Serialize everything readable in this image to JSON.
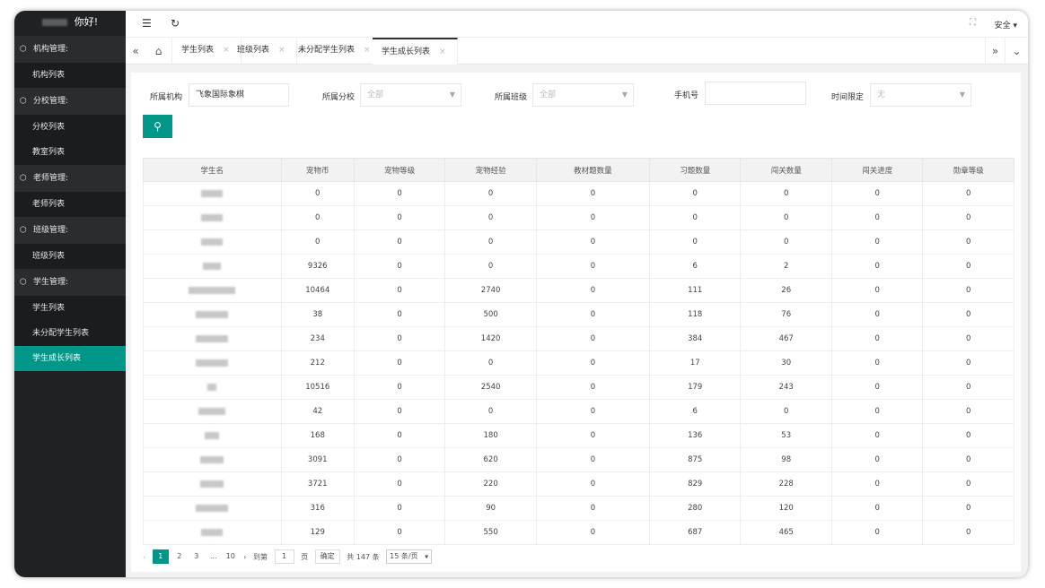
{
  "sidebar": {
    "greeting": "你好!",
    "groups": [
      {
        "label": "机构管理:",
        "items": [
          "机构列表"
        ]
      },
      {
        "label": "分校管理:",
        "items": [
          "分校列表",
          "教室列表"
        ]
      },
      {
        "label": "老师管理:",
        "items": [
          "老师列表"
        ]
      },
      {
        "label": "班级管理:",
        "items": [
          "班级列表"
        ]
      },
      {
        "label": "学生管理:",
        "items": [
          "学生列表",
          "未分配学生列表",
          "学生成长列表"
        ]
      }
    ],
    "active_item": "学生成长列表"
  },
  "topbar": {
    "user_menu": "安全"
  },
  "tabs": [
    {
      "label": "学生列表"
    },
    {
      "label": "班级列表"
    },
    {
      "label": "未分配学生列表"
    },
    {
      "label": "学生成长列表",
      "active": true
    }
  ],
  "filters": {
    "org_label": "所属机构",
    "org_value": "飞象国际象棋",
    "branch_label": "所属分校",
    "branch_value": "全部",
    "class_label": "所属班级",
    "class_value": "全部",
    "phone_label": "手机号",
    "phone_value": "",
    "time_label": "时间限定",
    "time_value": "无"
  },
  "table": {
    "columns": [
      "学生名",
      "宠物币",
      "宠物等级",
      "宠物经验",
      "教材题数量",
      "习题数量",
      "闯关数量",
      "闯关进度",
      "勋章等级"
    ],
    "rows": [
      [
        "0",
        "0",
        "0",
        "0",
        "0",
        "0",
        "0",
        "0"
      ],
      [
        "0",
        "0",
        "0",
        "0",
        "0",
        "0",
        "0",
        "0"
      ],
      [
        "0",
        "0",
        "0",
        "0",
        "0",
        "0",
        "0",
        "0"
      ],
      [
        "9326",
        "0",
        "0",
        "0",
        "6",
        "2",
        "0",
        "0"
      ],
      [
        "10464",
        "0",
        "2740",
        "0",
        "111",
        "26",
        "0",
        "0"
      ],
      [
        "38",
        "0",
        "500",
        "0",
        "118",
        "76",
        "0",
        "0"
      ],
      [
        "234",
        "0",
        "1420",
        "0",
        "384",
        "467",
        "0",
        "0"
      ],
      [
        "212",
        "0",
        "0",
        "0",
        "17",
        "30",
        "0",
        "0"
      ],
      [
        "10516",
        "0",
        "2540",
        "0",
        "179",
        "243",
        "0",
        "0"
      ],
      [
        "42",
        "0",
        "0",
        "0",
        "6",
        "0",
        "0",
        "0"
      ],
      [
        "168",
        "0",
        "180",
        "0",
        "136",
        "53",
        "0",
        "0"
      ],
      [
        "3091",
        "0",
        "620",
        "0",
        "875",
        "98",
        "0",
        "0"
      ],
      [
        "3721",
        "0",
        "220",
        "0",
        "829",
        "228",
        "0",
        "0"
      ],
      [
        "316",
        "0",
        "90",
        "0",
        "280",
        "120",
        "0",
        "0"
      ],
      [
        "129",
        "0",
        "550",
        "0",
        "687",
        "465",
        "0",
        "0"
      ]
    ]
  },
  "pager": {
    "pages": [
      "1",
      "2",
      "3",
      "...",
      "10"
    ],
    "goto_label": "到第",
    "goto_value": "1",
    "page_unit": "页",
    "confirm": "确定",
    "total": "共 147 条",
    "page_size": "15 条/页"
  }
}
